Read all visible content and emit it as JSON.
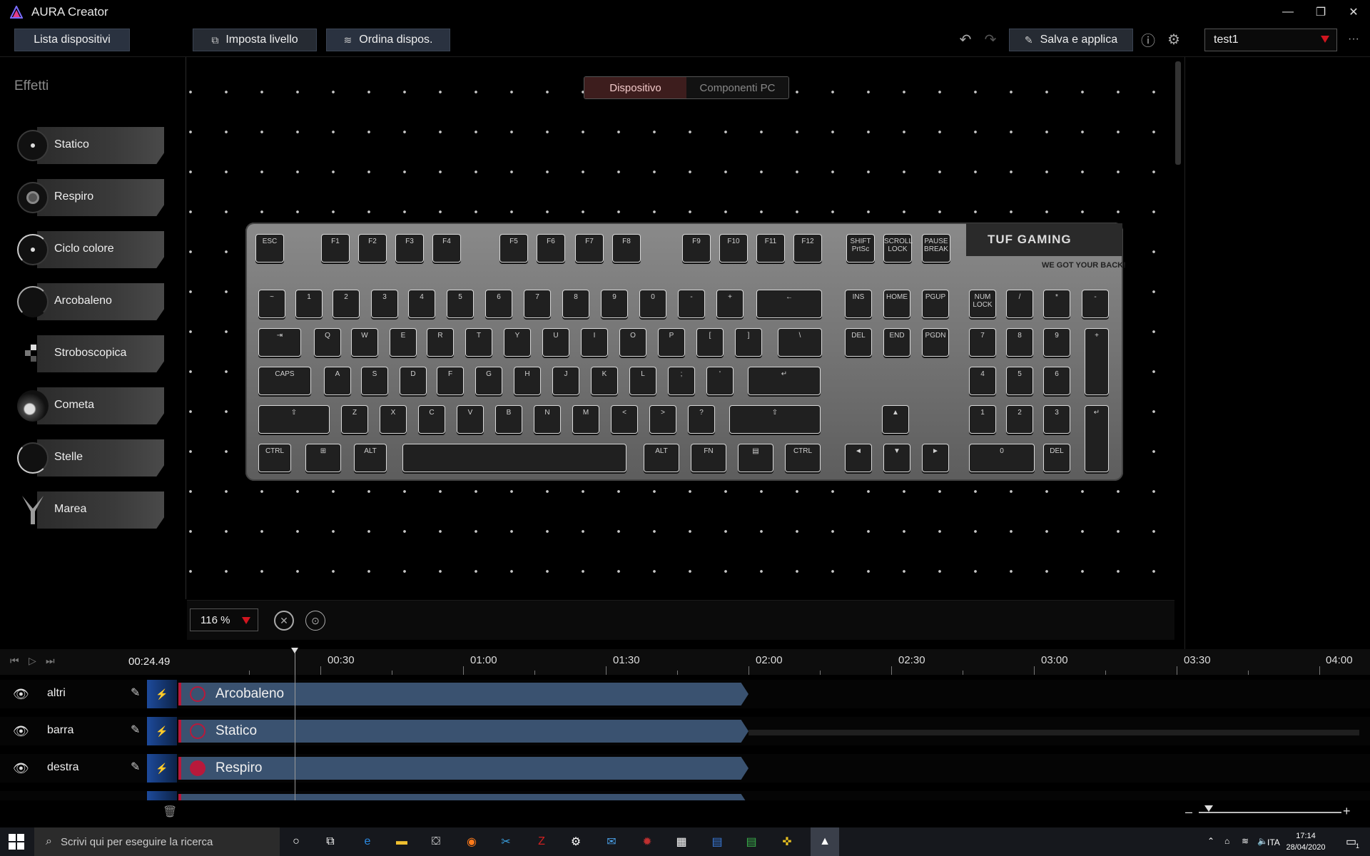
{
  "app": {
    "title": "AURA Creator",
    "logo_icon": "aura-logo-icon",
    "accent": "#d0151f"
  },
  "window_controls": {
    "minimize": "—",
    "maximize": "❐",
    "close": "✕"
  },
  "toolbar": {
    "device_list": "Lista dispositivi",
    "set_level": "Imposta livello",
    "order_devices": "Ordina dispos.",
    "save_apply": "Salva e applica",
    "profile_value": "test1",
    "more": "···"
  },
  "effects": {
    "title": "Effetti",
    "items": [
      {
        "label": "Statico",
        "icon": "static-icon"
      },
      {
        "label": "Respiro",
        "icon": "breathing-icon"
      },
      {
        "label": "Ciclo colore",
        "icon": "color-cycle-icon"
      },
      {
        "label": "Arcobaleno",
        "icon": "rainbow-icon"
      },
      {
        "label": "Stroboscopica",
        "icon": "strobe-icon"
      },
      {
        "label": "Cometa",
        "icon": "comet-icon"
      },
      {
        "label": "Stelle",
        "icon": "stars-icon"
      },
      {
        "label": "Marea",
        "icon": "tide-icon"
      }
    ]
  },
  "view_toggle": {
    "device": "Dispositivo",
    "pc_components": "Componenti PC",
    "selected": "Dispositivo"
  },
  "keyboard": {
    "brand": "TUF GAMING",
    "tagline": "WE GOT YOUR BACK!",
    "fkeys": [
      "ESC",
      "F1",
      "F2",
      "F3",
      "F4",
      "F5",
      "F6",
      "F7",
      "F8",
      "F9",
      "F10",
      "F11",
      "F12",
      "SHIFT PrtSc",
      "SCROLL LOCK",
      "PAUSE BREAK"
    ],
    "row1": [
      "~",
      "1",
      "2",
      "3",
      "4",
      "5",
      "6",
      "7",
      "8",
      "9",
      "0",
      "-",
      "+",
      "←",
      "INS",
      "HOME",
      "PGUP",
      "NUM LOCK",
      "/",
      "*",
      "-"
    ],
    "row2": [
      "⇥",
      "Q",
      "W",
      "E",
      "R",
      "T",
      "Y",
      "U",
      "I",
      "O",
      "P",
      "[",
      "]",
      "\\",
      "DEL",
      "END",
      "PGDN",
      "7",
      "8",
      "9",
      "+"
    ],
    "row3": [
      "CAPS",
      "A",
      "S",
      "D",
      "F",
      "G",
      "H",
      "J",
      "K",
      "L",
      ";",
      "'",
      "↵",
      "4",
      "5",
      "6"
    ],
    "row4": [
      "⇧",
      "Z",
      "X",
      "C",
      "V",
      "B",
      "N",
      "M",
      "<",
      ">",
      "?",
      "⇧",
      "▲",
      "1",
      "2",
      "3",
      "↵"
    ],
    "row5": [
      "CTRL",
      "⊞",
      "ALT",
      "",
      "ALT",
      "FN",
      "▤",
      "CTRL",
      "◄",
      "▼",
      "►",
      "0",
      "DEL"
    ]
  },
  "zoom": {
    "value": "116 %"
  },
  "timeline": {
    "current_time": "00:24.49",
    "marks": [
      "00:30",
      "01:00",
      "01:30",
      "02:00",
      "02:30",
      "03:00",
      "03:30",
      "04:00"
    ],
    "tracks": [
      {
        "name": "altri",
        "effect": "Arcobaleno"
      },
      {
        "name": "barra",
        "effect": "Statico"
      },
      {
        "name": "destra",
        "effect": "Respiro"
      }
    ]
  },
  "taskbar": {
    "search_placeholder": "Scrivi qui per eseguire la ricerca",
    "lang": "ITA",
    "time": "17:14",
    "date": "28/04/2020",
    "notifications": "1"
  }
}
